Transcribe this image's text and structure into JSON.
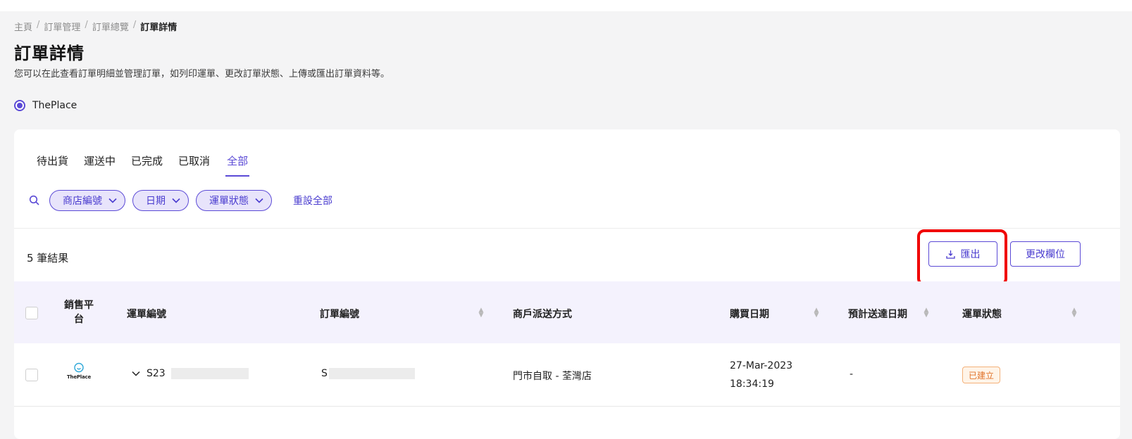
{
  "breadcrumb": [
    "主頁",
    "訂單管理",
    "訂單總覽",
    "訂單詳情"
  ],
  "breadcrumb_sep": "/",
  "page": {
    "title": "訂單詳情",
    "description": "您可以在此查看訂單明細並管理訂單，如列印運單、更改訂單狀態、上傳或匯出訂單資料等。"
  },
  "store_radio": {
    "label": "ThePlace",
    "selected": true
  },
  "tabs": [
    {
      "label": "待出貨",
      "active": false
    },
    {
      "label": "運送中",
      "active": false
    },
    {
      "label": "已完成",
      "active": false
    },
    {
      "label": "已取消",
      "active": false
    },
    {
      "label": "全部",
      "active": true
    }
  ],
  "filters": {
    "chips": [
      "商店編號",
      "日期",
      "運單狀態"
    ],
    "reset_label": "重設全部"
  },
  "results": {
    "count_label": "5 筆結果"
  },
  "actions": {
    "export_label": "匯出",
    "columns_label": "更改欄位"
  },
  "table": {
    "headers": {
      "platform": "銷售平台",
      "waybill": "運單編號",
      "order": "訂單編號",
      "delivery": "商戶派送方式",
      "purchase_date": "購買日期",
      "eta": "預計送達日期",
      "status": "運單狀態"
    },
    "rows": [
      {
        "platform_logo": "ThePlace",
        "waybill": "S23",
        "order": "S",
        "delivery": "門市自取 - 荃灣店",
        "purchase_date": "27-Mar-2023",
        "purchase_time": "18:34:19",
        "eta": "-",
        "status": "已建立"
      }
    ]
  },
  "colors": {
    "accent": "#5b4ad6",
    "highlight": "#f00000",
    "status_created": "#e0732b"
  }
}
